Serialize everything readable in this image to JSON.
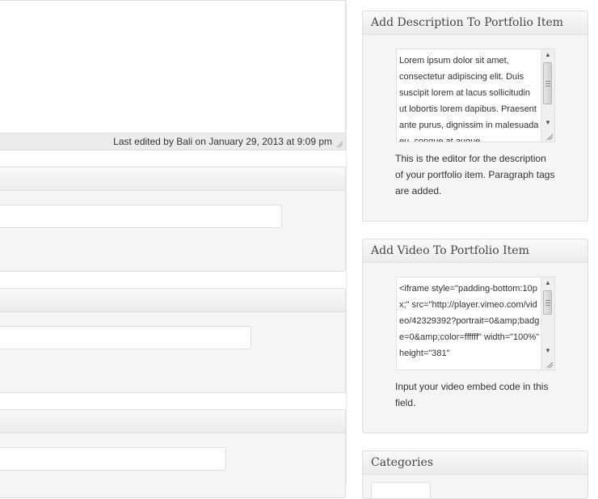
{
  "editor": {
    "last_edited": "Last edited by Bali on January 29, 2013 at 9:09 pm"
  },
  "description_box": {
    "title": "Add Description To Portfolio Item",
    "textarea_value": "Lorem ipsum dolor sit amet, consectetur adipiscing elit. Duis suscipit lorem at lacus sollicitudin ut lobortis lorem dapibus. Praesent ante purus, dignissim in malesuada eu, congue at augue.",
    "help": "This is the editor for the description of your portfolio item. Paragraph tags are added."
  },
  "video_box": {
    "title": "Add Video To Portfolio Item",
    "textarea_value": "<iframe style=\"padding-bottom:10px;\" src=\"http://player.vimeo.com/video/42329392?portrait=0&amp;badge=0&amp;color=ffffff\" width=\"100%\" height=\"381\"",
    "help": "Input your video embed code in this field."
  },
  "categories_box": {
    "title": "Categories"
  },
  "colors": {
    "border": "#dfdfdf",
    "panel_bg": "#f5f5f5"
  }
}
